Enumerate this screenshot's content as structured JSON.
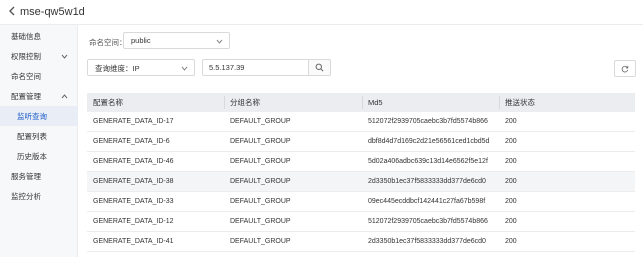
{
  "header": {
    "title": "mse-qw5w1d"
  },
  "sidebar": {
    "items": [
      {
        "label": "基础信息"
      },
      {
        "label": "权限控制"
      },
      {
        "label": "命名空间"
      },
      {
        "label": "配置管理"
      },
      {
        "label": "监听查询"
      },
      {
        "label": "配置列表"
      },
      {
        "label": "历史版本"
      },
      {
        "label": "服务管理"
      },
      {
        "label": "监控分析"
      }
    ]
  },
  "filters": {
    "namespace_label": "命名空间：",
    "namespace_value": "public",
    "dimension_value": "查询维度：IP",
    "ip_value": "5.5.137.39"
  },
  "table": {
    "columns": [
      "配置名称",
      "分组名称",
      "Md5",
      "推送状态"
    ],
    "rows": [
      [
        "GENERATE_DATA_ID-17",
        "DEFAULT_GROUP",
        "512072f2939705caebc3b7fd5574b866",
        "200"
      ],
      [
        "GENERATE_DATA_ID-6",
        "DEFAULT_GROUP",
        "dbf8d4d7d169c2d21e56561ced1cbd5d",
        "200"
      ],
      [
        "GENERATE_DATA_ID-46",
        "DEFAULT_GROUP",
        "5d02a406adbc639c13d14e6562f5e12f",
        "200"
      ],
      [
        "GENERATE_DATA_ID-38",
        "DEFAULT_GROUP",
        "2d3350b1ec37f5833333dd377de6cd0",
        "200"
      ],
      [
        "GENERATE_DATA_ID-33",
        "DEFAULT_GROUP",
        "09ec445ecddbcf142441c27fa67b598f",
        "200"
      ],
      [
        "GENERATE_DATA_ID-12",
        "DEFAULT_GROUP",
        "512072f2939705caebc3b7fd5574b866",
        "200"
      ],
      [
        "GENERATE_DATA_ID-41",
        "DEFAULT_GROUP",
        "2d3350b1ec37f5833333dd377de6cd0",
        "200"
      ]
    ]
  },
  "colors": {
    "accent": "#1a5ac8",
    "header_bg": "#ebedf1",
    "sidebar_bg": "#f7f8fa"
  }
}
